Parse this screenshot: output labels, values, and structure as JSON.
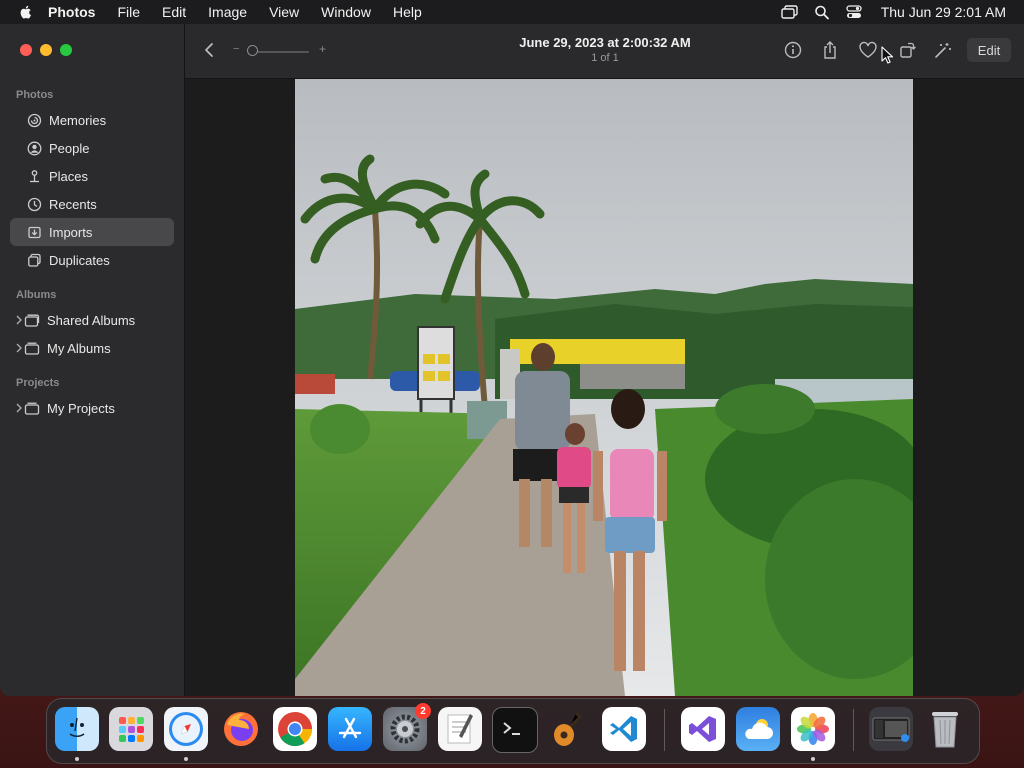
{
  "menubar": {
    "app_name": "Photos",
    "menus": [
      "File",
      "Edit",
      "Image",
      "View",
      "Window",
      "Help"
    ],
    "clock": "Thu Jun 29  2:01 AM"
  },
  "sidebar": {
    "sections": {
      "photos": "Photos",
      "albums": "Albums",
      "projects": "Projects"
    },
    "photo_items": [
      {
        "label": "Memories",
        "icon": "memories-icon"
      },
      {
        "label": "People",
        "icon": "people-icon"
      },
      {
        "label": "Places",
        "icon": "places-icon"
      },
      {
        "label": "Recents",
        "icon": "recents-icon"
      },
      {
        "label": "Imports",
        "icon": "imports-icon",
        "selected": true
      },
      {
        "label": "Duplicates",
        "icon": "duplicates-icon"
      }
    ],
    "album_items": [
      {
        "label": "Shared Albums",
        "icon": "shared-albums-icon"
      },
      {
        "label": "My Albums",
        "icon": "albums-icon"
      }
    ],
    "project_items": [
      {
        "label": "My Projects",
        "icon": "projects-icon"
      }
    ]
  },
  "toolbar": {
    "title": "June 29, 2023 at 2:00:32 AM",
    "subtitle": "1 of 1",
    "zoom_minus": "−",
    "zoom_plus": "+",
    "edit_label": "Edit",
    "icons": [
      "info-icon",
      "share-icon",
      "heart-icon",
      "rotate-icon",
      "magic-wand-icon"
    ]
  },
  "dock": {
    "apps": [
      "Finder",
      "Launchpad",
      "Safari",
      "Firefox",
      "Chrome",
      "App Store",
      "System Settings",
      "TextEdit",
      "Terminal",
      "GarageBand",
      "Visual Studio Code",
      "Visual Studio",
      "Weather",
      "Photos",
      "Window Preview",
      "Trash"
    ],
    "settings_badge": "2"
  },
  "colors": {
    "accent_selected": "#48484a",
    "close": "#ff5f57",
    "minimize": "#febc2e",
    "zoom": "#28c840",
    "badge": "#ff3b30"
  }
}
